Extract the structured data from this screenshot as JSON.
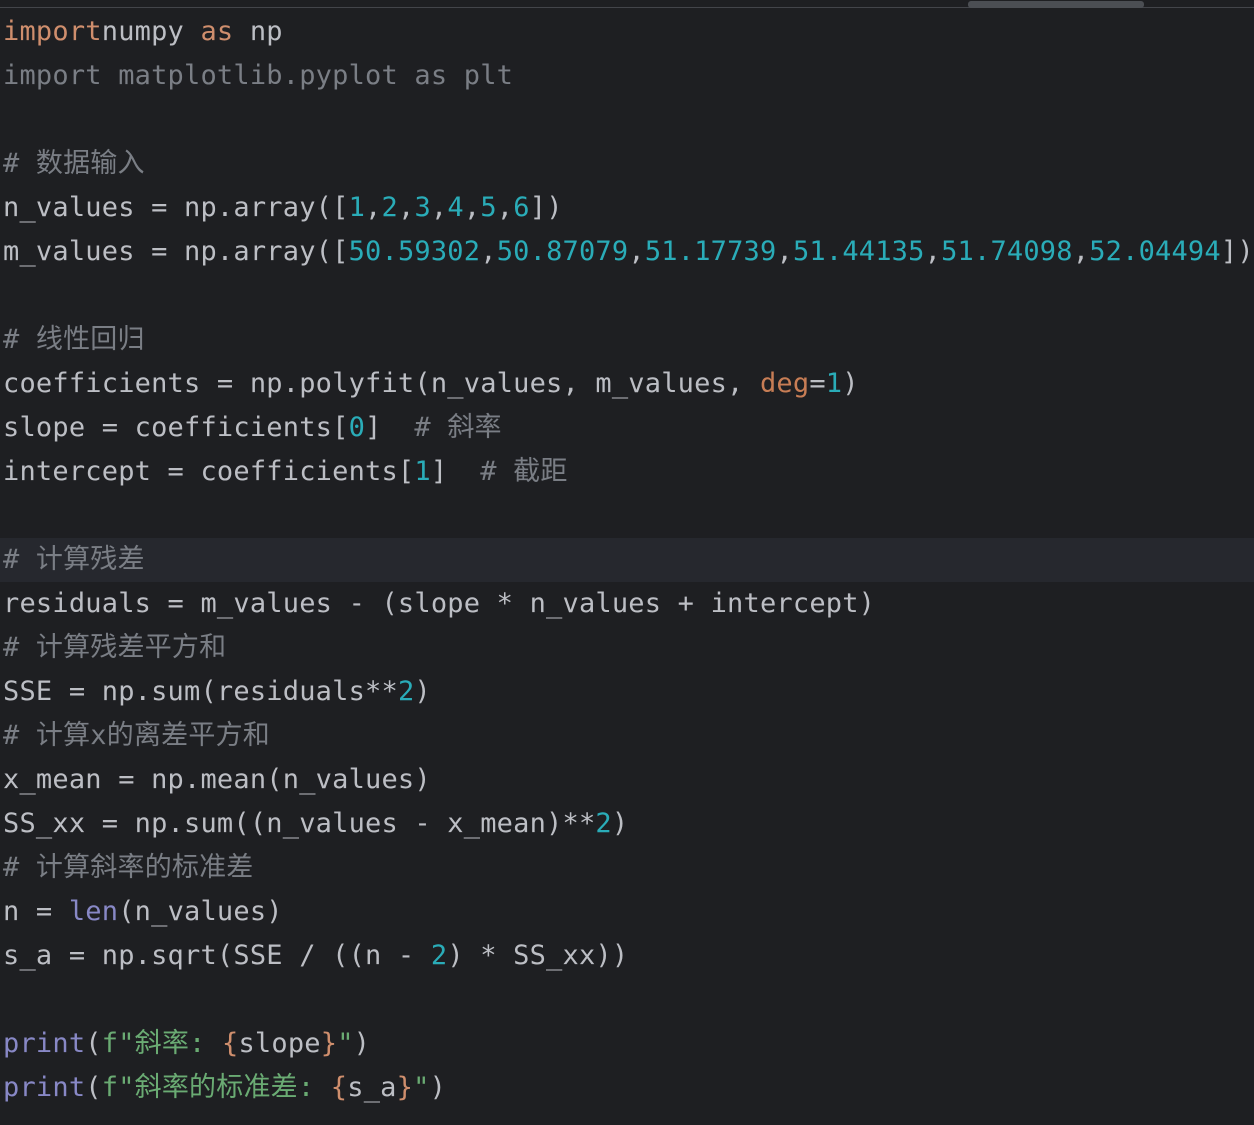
{
  "theme": {
    "background": "#1e1f22",
    "current_line": "#26282e",
    "text": "#bcbec4",
    "keyword": "#cf8e6d",
    "number": "#2aacb8",
    "comment": "#7a7e85",
    "builtin": "#8888c6",
    "string": "#6aab73",
    "param": "#c77d55"
  },
  "lines": [
    {
      "kind": "code",
      "tokens": [
        [
          "kw",
          "import"
        ],
        [
          "",
          "numpy "
        ],
        [
          "kw",
          "as"
        ],
        [
          "",
          " np"
        ]
      ]
    },
    {
      "kind": "code",
      "tokens": [
        [
          "dim",
          "import matplotlib.pyplot as plt"
        ]
      ]
    },
    {
      "kind": "blank",
      "tokens": []
    },
    {
      "kind": "comment",
      "tokens": [
        [
          "cmt",
          "# 数据输入"
        ]
      ]
    },
    {
      "kind": "code",
      "tokens": [
        [
          "",
          "n_values = np.array(["
        ],
        [
          "num",
          "1"
        ],
        [
          "",
          ","
        ],
        [
          "num",
          "2"
        ],
        [
          "",
          ","
        ],
        [
          "num",
          "3"
        ],
        [
          "",
          ","
        ],
        [
          "num",
          "4"
        ],
        [
          "",
          ","
        ],
        [
          "num",
          "5"
        ],
        [
          "",
          ","
        ],
        [
          "num",
          "6"
        ],
        [
          "",
          "])"
        ]
      ]
    },
    {
      "kind": "code",
      "tokens": [
        [
          "",
          "m_values = np.array(["
        ],
        [
          "num",
          "50.59302"
        ],
        [
          "",
          ","
        ],
        [
          "num",
          "50.87079"
        ],
        [
          "",
          ","
        ],
        [
          "num",
          "51.17739"
        ],
        [
          "",
          ","
        ],
        [
          "num",
          "51.44135"
        ],
        [
          "",
          ","
        ],
        [
          "num",
          "51.74098"
        ],
        [
          "",
          ","
        ],
        [
          "num",
          "52.04494"
        ],
        [
          "",
          "])"
        ]
      ]
    },
    {
      "kind": "blank",
      "tokens": []
    },
    {
      "kind": "comment",
      "tokens": [
        [
          "cmt",
          "# 线性回归"
        ]
      ]
    },
    {
      "kind": "code",
      "tokens": [
        [
          "",
          "coefficients = np.polyfit(n_values, m_values, "
        ],
        [
          "prm",
          "deg"
        ],
        [
          "",
          "="
        ],
        [
          "num",
          "1"
        ],
        [
          "",
          ")"
        ]
      ]
    },
    {
      "kind": "code",
      "tokens": [
        [
          "",
          "slope = coefficients["
        ],
        [
          "num",
          "0"
        ],
        [
          "",
          "]  "
        ],
        [
          "cmt",
          "# 斜率"
        ]
      ]
    },
    {
      "kind": "code",
      "tokens": [
        [
          "",
          "intercept = coefficients["
        ],
        [
          "num",
          "1"
        ],
        [
          "",
          "]  "
        ],
        [
          "cmt",
          "# 截距"
        ]
      ]
    },
    {
      "kind": "blank",
      "tokens": []
    },
    {
      "kind": "comment",
      "current": true,
      "tokens": [
        [
          "cmt",
          "# 计算残差"
        ]
      ]
    },
    {
      "kind": "code",
      "tokens": [
        [
          "",
          "residuals = m_values - (slope * n_values + intercept)"
        ]
      ]
    },
    {
      "kind": "comment",
      "tokens": [
        [
          "cmt",
          "# 计算残差平方和"
        ]
      ]
    },
    {
      "kind": "code",
      "tokens": [
        [
          "",
          "SSE = np.sum(residuals**"
        ],
        [
          "num",
          "2"
        ],
        [
          "",
          ")"
        ]
      ]
    },
    {
      "kind": "comment",
      "tokens": [
        [
          "cmt",
          "# 计算x的离差平方和"
        ]
      ]
    },
    {
      "kind": "code",
      "tokens": [
        [
          "",
          "x_mean = np.mean(n_values)"
        ]
      ]
    },
    {
      "kind": "code",
      "tokens": [
        [
          "",
          "SS_xx = np.sum((n_values - x_mean)**"
        ],
        [
          "num",
          "2"
        ],
        [
          "",
          ")"
        ]
      ]
    },
    {
      "kind": "comment",
      "tokens": [
        [
          "cmt",
          "# 计算斜率的标准差"
        ]
      ]
    },
    {
      "kind": "code",
      "tokens": [
        [
          "",
          "n = "
        ],
        [
          "bi",
          "len"
        ],
        [
          "",
          "(n_values)"
        ]
      ]
    },
    {
      "kind": "code",
      "tokens": [
        [
          "",
          "s_a = np.sqrt(SSE / ((n - "
        ],
        [
          "num",
          "2"
        ],
        [
          "",
          ") * SS_xx))"
        ]
      ]
    },
    {
      "kind": "blank",
      "tokens": []
    },
    {
      "kind": "code",
      "tokens": [
        [
          "bi",
          "print"
        ],
        [
          "",
          "("
        ],
        [
          "str",
          "f\"斜率: "
        ],
        [
          "brace",
          "{"
        ],
        [
          "",
          "slope"
        ],
        [
          "brace",
          "}"
        ],
        [
          "str",
          "\""
        ],
        [
          "",
          ")"
        ]
      ]
    },
    {
      "kind": "code",
      "tokens": [
        [
          "bi",
          "print"
        ],
        [
          "",
          "("
        ],
        [
          "str",
          "f\"斜率的标准差: "
        ],
        [
          "brace",
          "{"
        ],
        [
          "",
          "s_a"
        ],
        [
          "brace",
          "}"
        ],
        [
          "str",
          "\""
        ],
        [
          "",
          ")"
        ]
      ]
    }
  ]
}
